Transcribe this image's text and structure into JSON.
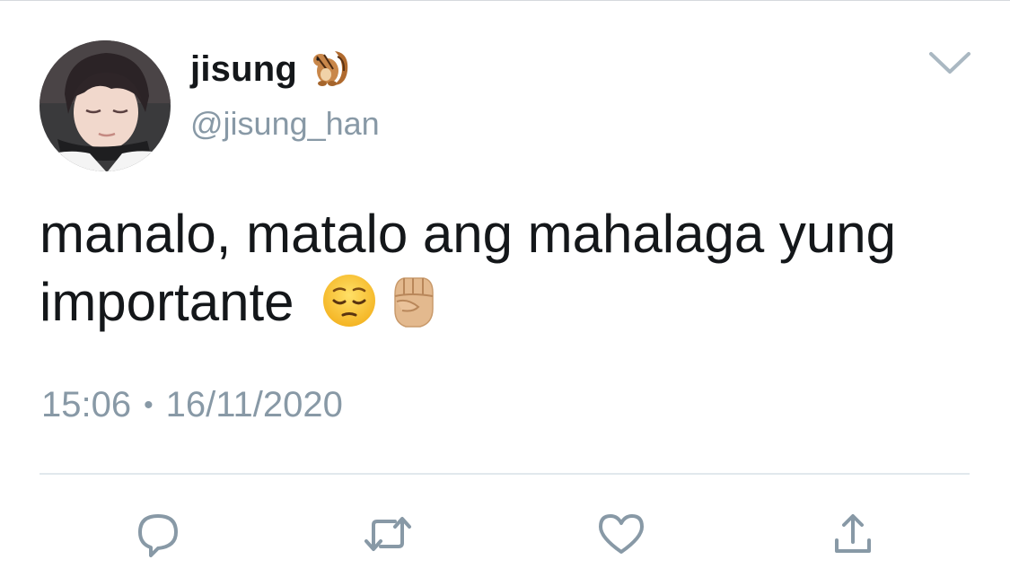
{
  "tweet": {
    "display_name": "jisung",
    "name_emoji": "chipmunk",
    "handle": "@jisung_han",
    "text_line1": "manalo, matalo ang mahalaga yung",
    "text_line2": "importante",
    "text_emojis": [
      "pensive-face",
      "raised-fist-medium-light-skin-tone"
    ],
    "time": "15:06",
    "separator": "•",
    "date": "16/11/2020"
  },
  "actions": [
    {
      "name": "reply",
      "icon": "reply-icon"
    },
    {
      "name": "retweet",
      "icon": "retweet-icon"
    },
    {
      "name": "like",
      "icon": "heart-icon"
    },
    {
      "name": "share",
      "icon": "share-icon"
    }
  ],
  "colors": {
    "text": "#14171a",
    "secondary": "#8899a6",
    "divider": "#e1e8ed"
  }
}
